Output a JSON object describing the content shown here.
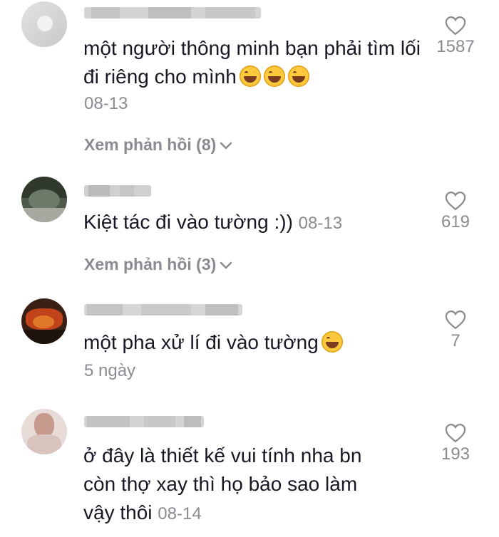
{
  "comments": [
    {
      "text": "một người thông minh bạn phải tìm lối đi riêng cho mình",
      "emoji_count": 3,
      "date": "08-13",
      "replies": "Xem phản hồi (8)",
      "likes": "1587"
    },
    {
      "text": "Kiệt tác đi vào tường :))",
      "date": "08-13",
      "replies": "Xem phản hồi (3)",
      "likes": "619"
    },
    {
      "text": "một pha xử lí đi vào tường",
      "emoji_count": 1,
      "date": "5 ngày",
      "likes": "7"
    },
    {
      "text_line1": "ở đây là thiết kế vui tính nha bn",
      "text_line2": "còn thợ xay thì họ bảo sao làm",
      "text_line3": "vậy thôi",
      "date": "08-14",
      "likes": "193"
    }
  ],
  "icons": {
    "like": "heart-outline-icon",
    "expand": "chevron-down-icon",
    "emoji": "laughing-tears-emoji"
  },
  "colors": {
    "text": "#161823",
    "secondary": "#8a8b91",
    "emoji": "#ffc93d"
  }
}
